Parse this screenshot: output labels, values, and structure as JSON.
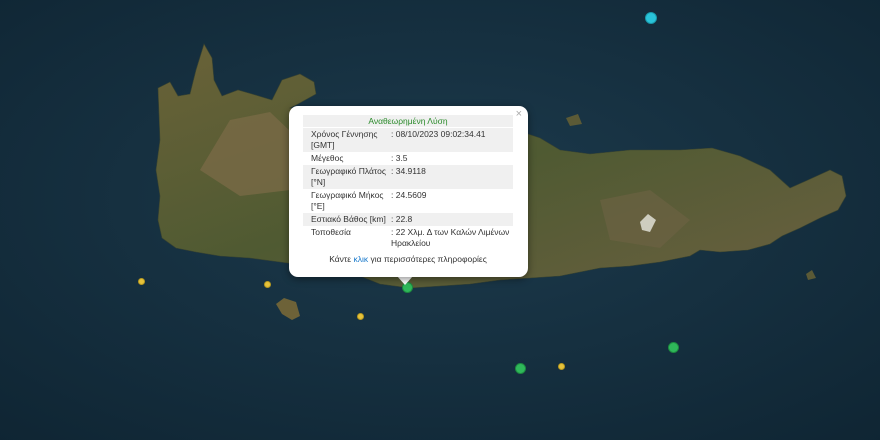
{
  "popup": {
    "header": "Αναθεωρημένη Λύση",
    "close_label": "×",
    "rows": [
      {
        "label": "Χρόνος Γέννησης [GMT]",
        "value": ": 08/10/2023 09:02:34.41"
      },
      {
        "label": "Μέγεθος",
        "value": ": 3.5"
      },
      {
        "label": "Γεωγραφικό Πλάτος [°N]",
        "value": ": 34.9118"
      },
      {
        "label": "Γεωγραφικό Μήκος [°E]",
        "value": ": 24.5609"
      },
      {
        "label": "Εστιακό Βάθος [km]",
        "value": ": 22.8"
      },
      {
        "label": "Τοποθεσία",
        "value": ": 22 Χλμ. Δ των Καλών Λιμένων Ηρακλείου"
      }
    ],
    "more_prefix": "Κάντε ",
    "more_link": "κλικ",
    "more_suffix": " για περισσότερες πληροφορίες"
  },
  "markers": [
    {
      "color": "cyan"
    },
    {
      "color": "green"
    },
    {
      "color": "green"
    },
    {
      "color": "green"
    },
    {
      "color": "yellow"
    },
    {
      "color": "yellow"
    },
    {
      "color": "yellow"
    },
    {
      "color": "yellow"
    }
  ],
  "colors": {
    "sea": "#16303f",
    "land": "#5b5a36",
    "mountain": "#7a6a45",
    "header_text": "#2a8a2a",
    "link": "#1a7acc"
  }
}
